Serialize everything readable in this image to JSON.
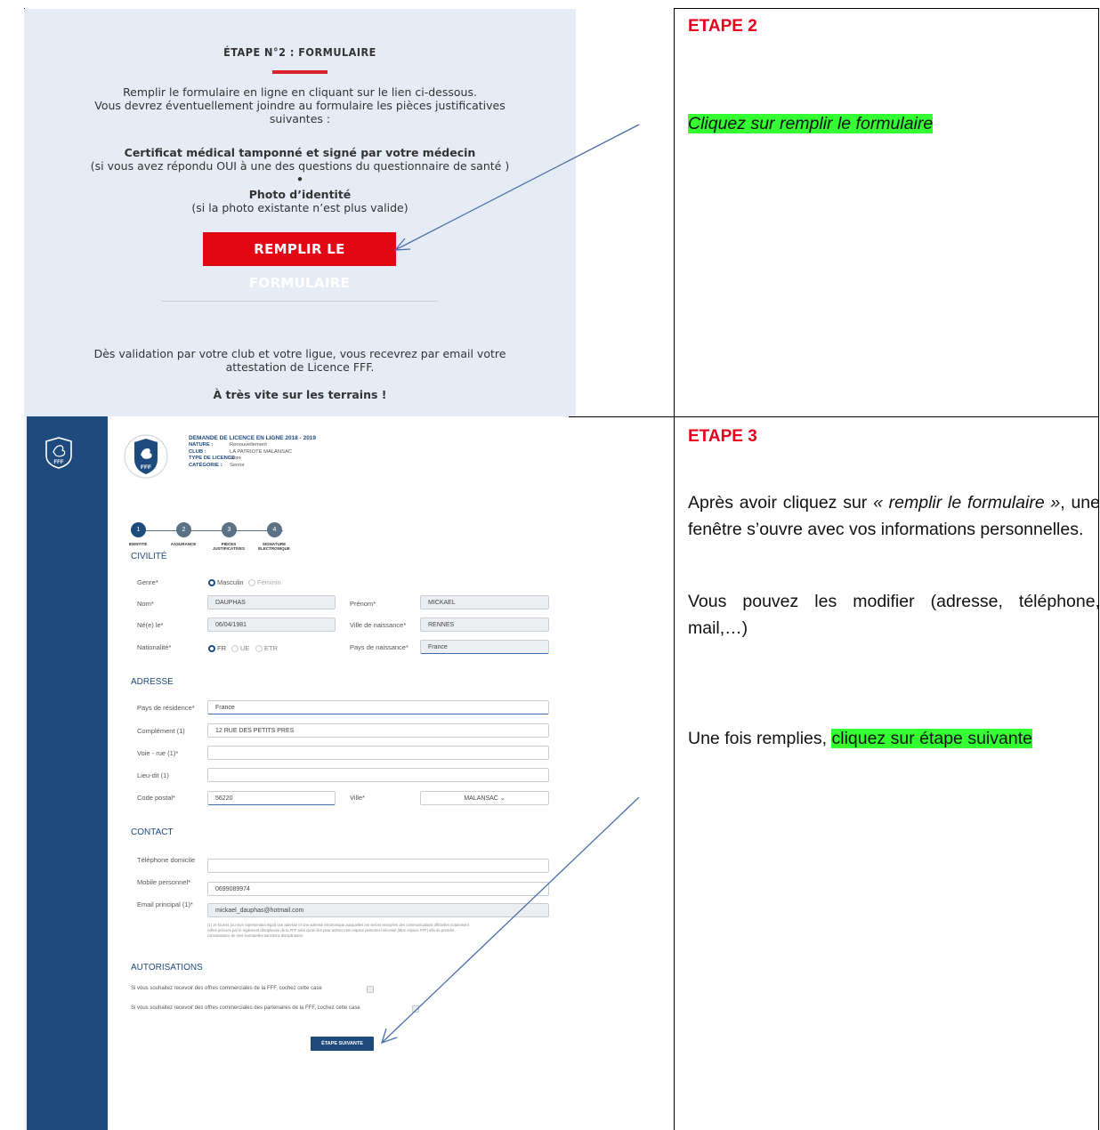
{
  "step2": {
    "panel": {
      "title": "ÉTAPE N°2 : FORMULAIRE",
      "intro_1": "Remplir le formulaire en ligne en cliquant sur le lien ci-dessous.",
      "intro_2": "Vous devrez éventuellement joindre au formulaire les pièces justificatives",
      "intro_3": "suivantes :",
      "doc1_title": "Certificat médical tamponné et signé par votre médecin",
      "doc1_note": "(si vous avez répondu OUI à une des questions du questionnaire de santé )",
      "bullet": "•",
      "doc2_title": "Photo d’identité",
      "doc2_note": "(si la photo existante n’est plus valide)",
      "button": "REMPLIR LE FORMULAIRE",
      "footer_1": "Dès validation par votre club et votre ligue, vous recevrez par email votre",
      "footer_2": "attestation de Licence FFF.",
      "closing": "À très vite sur les terrains !"
    },
    "heading": "ETAPE 2",
    "instruction": "Cliquez sur remplir le formulaire"
  },
  "step3": {
    "heading": "ETAPE 3",
    "para1_a": "Après avoir cliquez sur ",
    "para1_em": "« remplir le formulaire »",
    "para1_b": ", une fenêtre s’ouvre avec vos informations personnelles.",
    "para2": "Vous pouvez les modifier (adresse, téléphone, mail,…)",
    "para3_a": "Une fois remplies, ",
    "para3_hl": "cliquez sur étape suivante",
    "form": {
      "logo_text": "FFF",
      "header_title": "DEMANDE DE LICENCE EN LIGNE 2018 - 2019",
      "meta": [
        {
          "k": "NATURE :",
          "v": "Renouvellement"
        },
        {
          "k": "CLUB :",
          "v": "LA PATRIOTE MALANSAC"
        },
        {
          "k": "TYPE DE LICENCE :",
          "v": "Libre"
        },
        {
          "k": "CATÉGORIE :",
          "v": "Senior"
        }
      ],
      "steps": [
        {
          "n": "1",
          "label": "IDENTITÉ"
        },
        {
          "n": "2",
          "label": "ASSURANCE"
        },
        {
          "n": "3",
          "label": "PIÈCES JUSTIFICATIVES"
        },
        {
          "n": "4",
          "label": "SIGNATURE ÉLECTRONIQUE"
        }
      ],
      "civ": {
        "title": "CIVILITÉ",
        "genre_label": "Genre*",
        "genre_opt1": "Masculin",
        "genre_opt2": "Féminin",
        "nom_label": "Nom*",
        "nom_value": "DAUPHAS",
        "prenom_label": "Prénom*",
        "prenom_value": "MICKAEL",
        "ne_label": "Né(e) le*",
        "ne_value": "06/04/1981",
        "ville_naiss_label": "Ville de naissance*",
        "ville_naiss_value": "RENNES",
        "nat_label": "Nationalité*",
        "nat_opt1": "FR",
        "nat_opt2": "UE",
        "nat_opt3": "ETR",
        "pays_naiss_label": "Pays de naissance*",
        "pays_naiss_value": "France"
      },
      "adr": {
        "title": "ADRESSE",
        "pays_label": "Pays de résidence*",
        "pays_value": "France",
        "compl_label": "Complément (1)",
        "compl_value": "12 RUE DES PETITS PRES",
        "voie_label": "Voie - rue (1)*",
        "lieu_label": "Lieu-dit (1)",
        "cp_label": "Code postal*",
        "cp_value": "56220",
        "ville_label": "Ville*",
        "ville_value": "MALANSAC ⌄"
      },
      "contact": {
        "title": "CONTACT",
        "tel_label": "Téléphone domicile",
        "mob_label": "Mobile personnel*",
        "mob_value": "0699089974",
        "email_label": "Email principal (1)*",
        "email_value": "mickael_dauphas@hotmail.com",
        "note_1": "(1) Je fournis (ou mon représentant légal) une adresse et une adresse électronique auxquelles me seront envoyées des communications officielles notamment",
        "note_2": "celles prévues par le règlement disciplinaire de la FFF ainsi qu'un lien pour activer mon espace personnel sécurisé (Mon espace FFF) afin de prendre",
        "note_3": "connaissance de mes éventuelles sanctions disciplinaires."
      },
      "auth": {
        "title": "AUTORISATIONS",
        "opt1": "Si vous souhaitez recevoir des offres commerciales de la FFF, cochez cette case",
        "opt2": "Si vous souhaitez recevoir des offres commerciales des partenaires de la FFF, cochez cette case"
      },
      "next_button": "ÉTAPE SUIVANTE"
    }
  },
  "colors": {
    "fff_red": "#e30613",
    "fff_blue": "#1e4a7e",
    "highlight": "#33ff33",
    "arrow": "#4a6fa8"
  }
}
